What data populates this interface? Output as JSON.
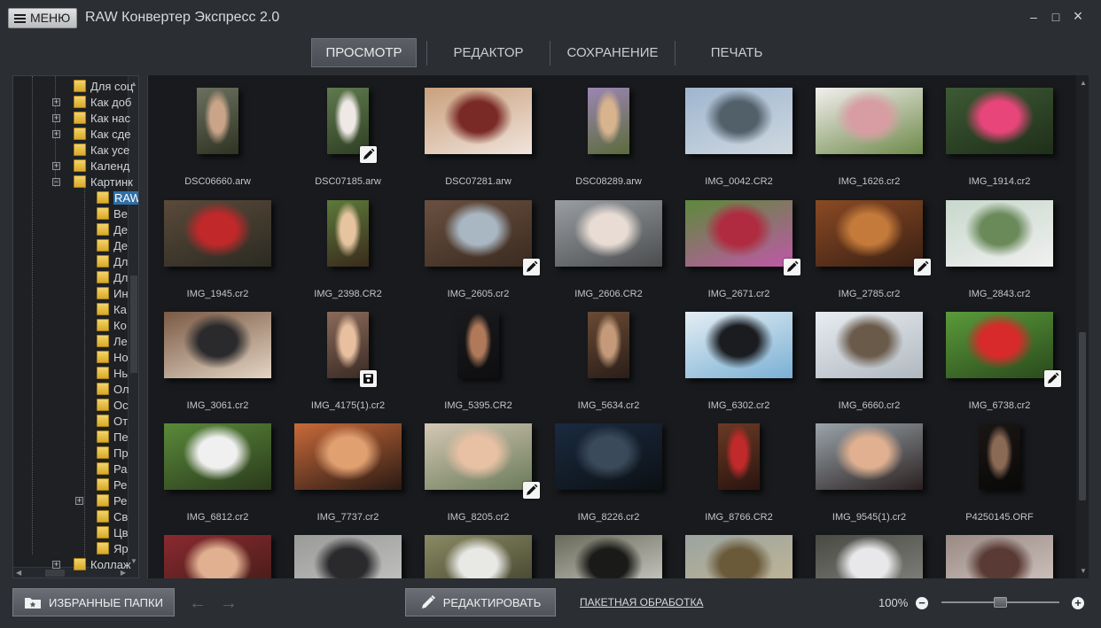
{
  "titlebar": {
    "menu_label": "МЕНЮ",
    "title": "RAW Конвертер Экспресс 2.0",
    "minimize": "–",
    "maximize": "□",
    "close": "×"
  },
  "tabs": [
    {
      "label": "ПРОСМОТР",
      "active": true
    },
    {
      "label": "РЕДАКТОР",
      "active": false
    },
    {
      "label": "СОХРАНЕНИЕ",
      "active": false
    },
    {
      "label": "ПЕЧАТЬ",
      "active": false
    }
  ],
  "tree": {
    "items": [
      {
        "label": "Для соц",
        "expander": ""
      },
      {
        "label": "Как доб",
        "expander": "+"
      },
      {
        "label": "Как нас",
        "expander": "+"
      },
      {
        "label": "Как сде",
        "expander": "+"
      },
      {
        "label": "Как усе",
        "expander": ""
      },
      {
        "label": "Календ",
        "expander": "+"
      },
      {
        "label": "Картинк",
        "expander": "−"
      },
      {
        "label": "RAW",
        "expander": "",
        "selected": true
      },
      {
        "label": "Ве",
        "expander": ""
      },
      {
        "label": "Де",
        "expander": ""
      },
      {
        "label": "Де",
        "expander": ""
      },
      {
        "label": "Дл",
        "expander": ""
      },
      {
        "label": "Дл",
        "expander": ""
      },
      {
        "label": "Ин",
        "expander": ""
      },
      {
        "label": "Ка",
        "expander": ""
      },
      {
        "label": "Ко",
        "expander": ""
      },
      {
        "label": "Ле",
        "expander": ""
      },
      {
        "label": "Но",
        "expander": ""
      },
      {
        "label": "Нь",
        "expander": ""
      },
      {
        "label": "Ол",
        "expander": ""
      },
      {
        "label": "Ос",
        "expander": ""
      },
      {
        "label": "От",
        "expander": ""
      },
      {
        "label": "Пе",
        "expander": ""
      },
      {
        "label": "Пр",
        "expander": ""
      },
      {
        "label": "Ра",
        "expander": ""
      },
      {
        "label": "Ре",
        "expander": ""
      },
      {
        "label": "Ре",
        "expander": "+"
      },
      {
        "label": "Св",
        "expander": ""
      },
      {
        "label": "Цв",
        "expander": ""
      },
      {
        "label": "Яр",
        "expander": ""
      },
      {
        "label": "Коллаж",
        "expander": "+"
      }
    ]
  },
  "gallery": {
    "rows": [
      [
        {
          "name": "DSC06660.arw",
          "shape": "portrait",
          "colors": [
            "#6b7060",
            "#c9a488",
            "#2e3322"
          ],
          "badge": ""
        },
        {
          "name": "DSC07185.arw",
          "shape": "portrait",
          "colors": [
            "#5f7a4e",
            "#efe9e6",
            "#2f3f24"
          ],
          "badge": "edit"
        },
        {
          "name": "DSC07281.arw",
          "shape": "landscape",
          "colors": [
            "#c9a07c",
            "#7a2a26",
            "#f0e4dc"
          ],
          "badge": ""
        },
        {
          "name": "DSC08289.arw",
          "shape": "portrait",
          "colors": [
            "#9c86b4",
            "#d8b48e",
            "#5b6b3a"
          ],
          "badge": ""
        },
        {
          "name": "IMG_0042.CR2",
          "shape": "landscape",
          "colors": [
            "#9fb6cf",
            "#52606a",
            "#cfd8e0"
          ],
          "badge": ""
        },
        {
          "name": "IMG_1626.cr2",
          "shape": "landscape",
          "colors": [
            "#f2efee",
            "#d89da2",
            "#6f8a4a"
          ],
          "badge": ""
        },
        {
          "name": "IMG_1914.cr2",
          "shape": "landscape",
          "colors": [
            "#3d5a34",
            "#e8467a",
            "#1f2f1a"
          ],
          "badge": ""
        }
      ],
      [
        {
          "name": "IMG_1945.cr2",
          "shape": "landscape",
          "colors": [
            "#5a4a3a",
            "#c0282a",
            "#2b2a22"
          ],
          "badge": ""
        },
        {
          "name": "IMG_2398.CR2",
          "shape": "portrait",
          "colors": [
            "#5c7a3a",
            "#e6c4a0",
            "#3a2a1c"
          ],
          "badge": ""
        },
        {
          "name": "IMG_2605.cr2",
          "shape": "landscape",
          "colors": [
            "#6a5040",
            "#a9b7c3",
            "#3a2a20"
          ],
          "badge": "edit"
        },
        {
          "name": "IMG_2606.CR2",
          "shape": "landscape",
          "colors": [
            "#9a9ea2",
            "#e8dcd4",
            "#4a4c4e"
          ],
          "badge": ""
        },
        {
          "name": "IMG_2671.cr2",
          "shape": "landscape",
          "colors": [
            "#5c8a3a",
            "#b02a40",
            "#c058a8"
          ],
          "badge": "edit"
        },
        {
          "name": "IMG_2785.cr2",
          "shape": "landscape",
          "colors": [
            "#8a4a24",
            "#c47a3a",
            "#3a2014"
          ],
          "badge": "edit"
        },
        {
          "name": "IMG_2843.cr2",
          "shape": "landscape",
          "colors": [
            "#c8d8cc",
            "#6a8a5a",
            "#f0f0f0"
          ],
          "badge": ""
        }
      ],
      [
        {
          "name": "IMG_3061.cr2",
          "shape": "landscape",
          "colors": [
            "#7a5a44",
            "#2a2a2c",
            "#e4d4c4"
          ],
          "badge": ""
        },
        {
          "name": "IMG_4175(1).cr2",
          "shape": "portrait",
          "colors": [
            "#8a6a5a",
            "#e8c0a0",
            "#3a2a24"
          ],
          "badge": "save"
        },
        {
          "name": "IMG_5395.CR2",
          "shape": "portrait-narrow",
          "colors": [
            "#1a1a1c",
            "#b07a5a",
            "#0e0e10"
          ],
          "badge": ""
        },
        {
          "name": "IMG_5634.cr2",
          "shape": "portrait-narrow",
          "colors": [
            "#6a4a34",
            "#c49a7a",
            "#2a1e18"
          ],
          "badge": ""
        },
        {
          "name": "IMG_6302.cr2",
          "shape": "landscape",
          "colors": [
            "#e4eef4",
            "#1a1c20",
            "#7ab0d4"
          ],
          "badge": ""
        },
        {
          "name": "IMG_6660.cr2",
          "shape": "landscape",
          "colors": [
            "#e8ecf0",
            "#6a5a4a",
            "#b0b8c0"
          ],
          "badge": ""
        },
        {
          "name": "IMG_6738.cr2",
          "shape": "landscape",
          "colors": [
            "#5a9a3a",
            "#d82a2a",
            "#2a4a1c"
          ],
          "badge": "edit"
        }
      ],
      [
        {
          "name": "IMG_6812.cr2",
          "shape": "landscape",
          "colors": [
            "#5a8a3a",
            "#f0f0f0",
            "#2a3a1c"
          ],
          "badge": ""
        },
        {
          "name": "IMG_7737.cr2",
          "shape": "landscape",
          "colors": [
            "#c86a3a",
            "#e0a070",
            "#2a1a14"
          ],
          "badge": ""
        },
        {
          "name": "IMG_8205.cr2",
          "shape": "landscape",
          "colors": [
            "#d4c8b4",
            "#e8c0a4",
            "#6a7a5a"
          ],
          "badge": "edit"
        },
        {
          "name": "IMG_8226.cr2",
          "shape": "landscape",
          "colors": [
            "#1a2a40",
            "#3a4a5a",
            "#0c1014"
          ],
          "badge": ""
        },
        {
          "name": "IMG_8766.CR2",
          "shape": "portrait-narrow",
          "colors": [
            "#6a3a24",
            "#c02a2a",
            "#2a1410"
          ],
          "badge": ""
        },
        {
          "name": "IMG_9545(1).cr2",
          "shape": "landscape",
          "colors": [
            "#9aa4aa",
            "#e0b090",
            "#2a2020"
          ],
          "badge": ""
        },
        {
          "name": "P4250145.ORF",
          "shape": "portrait-narrow",
          "colors": [
            "#1a1614",
            "#8a6a54",
            "#0a0808"
          ],
          "badge": ""
        }
      ],
      [
        {
          "name": "",
          "shape": "landscape",
          "colors": [
            "#8a2a30",
            "#e0b090",
            "#3a1a14"
          ],
          "badge": ""
        },
        {
          "name": "",
          "shape": "landscape",
          "colors": [
            "#9a9a98",
            "#2a2a2c",
            "#c8c8c6"
          ],
          "badge": ""
        },
        {
          "name": "",
          "shape": "landscape",
          "colors": [
            "#8a8a64",
            "#e8e8e4",
            "#3a3a28"
          ],
          "badge": ""
        },
        {
          "name": "",
          "shape": "landscape",
          "colors": [
            "#6a6a5a",
            "#1a1a18",
            "#d8d8d4"
          ],
          "badge": ""
        },
        {
          "name": "",
          "shape": "landscape",
          "colors": [
            "#9aa4a0",
            "#6a5a3a",
            "#c8b894"
          ],
          "badge": ""
        },
        {
          "name": "",
          "shape": "landscape",
          "colors": [
            "#4a4a44",
            "#e8e8ea",
            "#8a8a84"
          ],
          "badge": ""
        },
        {
          "name": "",
          "shape": "landscape",
          "colors": [
            "#9a8a84",
            "#5a3a34",
            "#d8ccc8"
          ],
          "badge": ""
        }
      ]
    ]
  },
  "bottom": {
    "favorites_label": "ИЗБРАННЫЕ ПАПКИ",
    "back_arrow": "←",
    "forward_arrow": "→",
    "edit_label": "РЕДАКТИРОВАТЬ",
    "batch_label": "ПАКЕТНАЯ ОБРАБОТКА",
    "zoom": "100%",
    "zoom_minus": "−",
    "zoom_plus": "+",
    "zoom_slider_fraction": 0.5
  }
}
